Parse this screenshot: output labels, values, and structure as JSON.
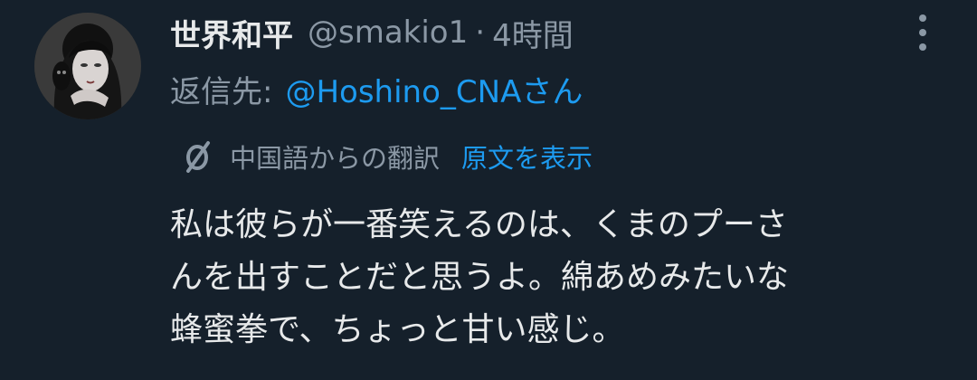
{
  "author": {
    "display_name": "世界和平",
    "handle": "@smakio1",
    "separator": "·",
    "time": "4時間"
  },
  "reply": {
    "label": "返信先:",
    "target": "@Hoshino_CNAさん"
  },
  "translation": {
    "label": "中国語からの翻訳",
    "show_original": "原文を表示",
    "icon": "translate-icon"
  },
  "body": {
    "lines": [
      "私は彼らが一番笑えるのは、くまのプーさ",
      "んを出すことだと思うよ。綿あめみたいな",
      "蜂蜜拳で、ちょっと甘い感じ。"
    ]
  },
  "colors": {
    "background": "#15202b",
    "primary_text": "#e7e9ea",
    "secondary_text": "#8b98a5",
    "link": "#1d9bf0"
  }
}
